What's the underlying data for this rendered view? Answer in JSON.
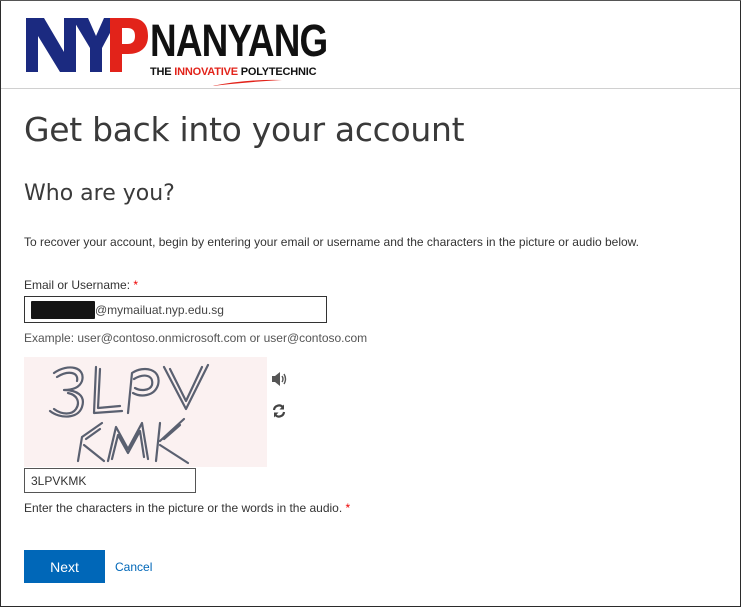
{
  "logo": {
    "wordmark": "NANYANG",
    "tagline_prefix": "THE ",
    "tagline_highlight": "INNOVATIVE",
    "tagline_suffix": " POLYTECHNIC",
    "colors": {
      "blue": "#1b2a80",
      "red": "#e2231a"
    }
  },
  "page": {
    "title": "Get back into your account",
    "subtitle": "Who are you?",
    "intro": "To recover your account, begin by entering your email or username and the characters in the picture or audio below."
  },
  "email": {
    "label": "Email or Username:",
    "required_mark": "*",
    "value_visible": "@mymailuat.nyp.edu.sg",
    "example": "Example: user@contoso.onmicrosoft.com or user@contoso.com"
  },
  "captcha": {
    "image_text": "3LPVKMK",
    "input_value": "3LPVKMK",
    "hint": "Enter the characters in the picture or the words in the audio.",
    "required_mark": "*",
    "icons": {
      "audio": "speaker-icon",
      "refresh": "refresh-icon"
    }
  },
  "actions": {
    "next_label": "Next",
    "cancel_label": "Cancel",
    "accent": "#0067b8"
  }
}
